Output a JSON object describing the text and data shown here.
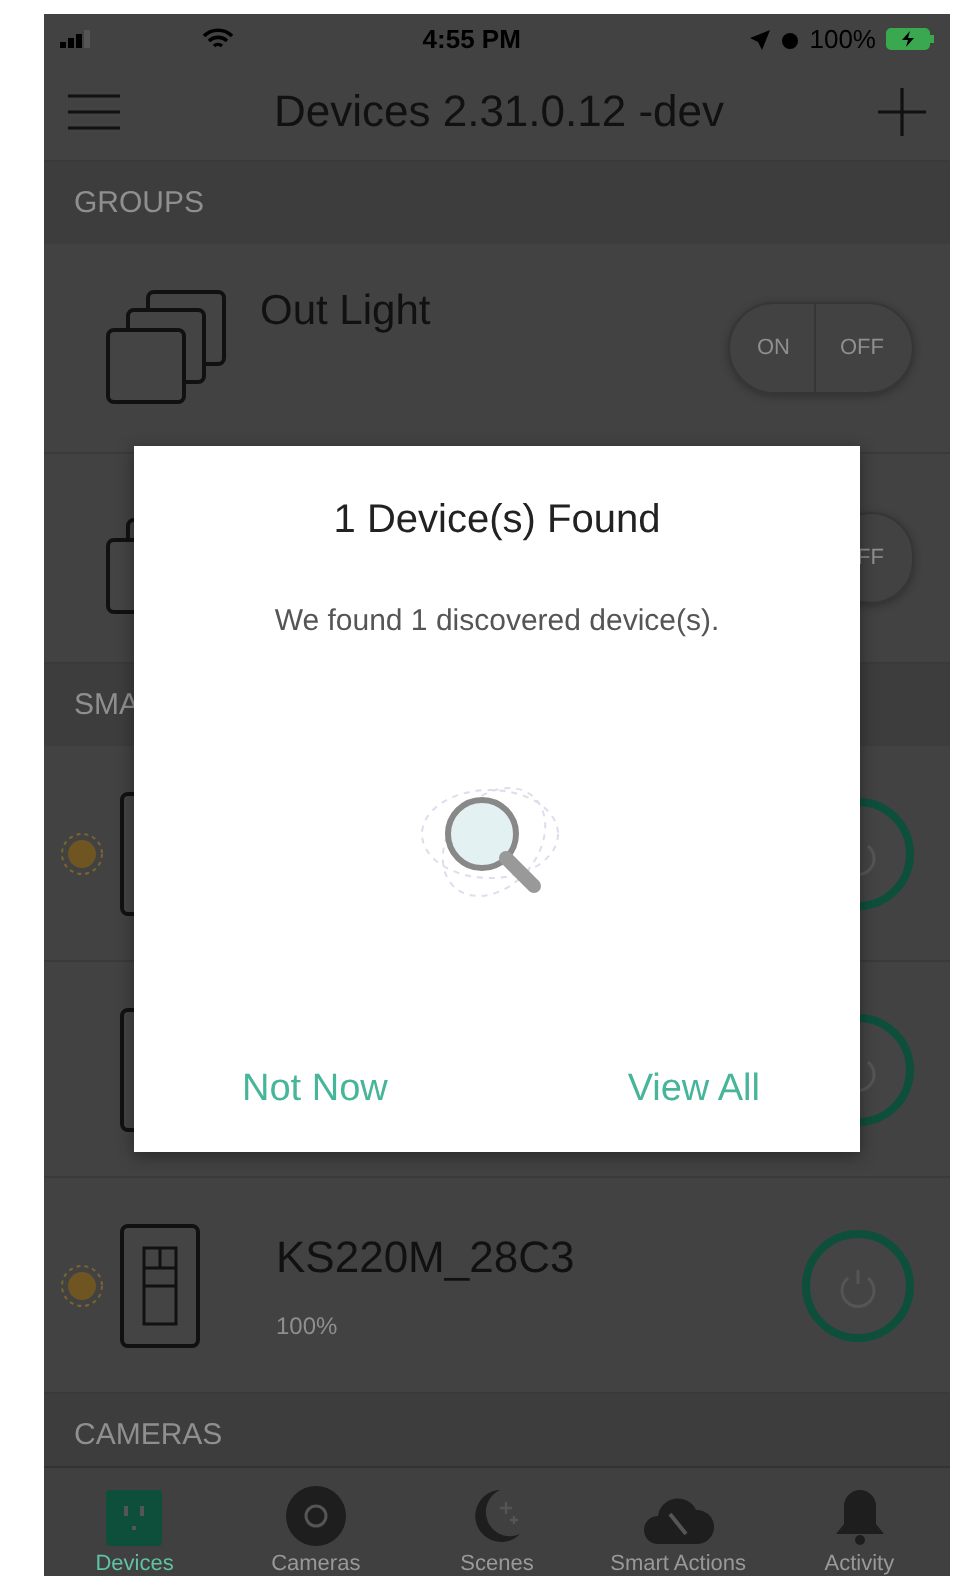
{
  "status_bar": {
    "time": "4:55 PM",
    "battery": "100%"
  },
  "nav": {
    "title": "Devices 2.31.0.12 -dev"
  },
  "groups": {
    "header": "GROUPS",
    "items": [
      {
        "name": "Out Light",
        "toggle_labels": [
          "ON",
          "OFF"
        ]
      },
      {
        "toggle_labels": [
          "FF"
        ]
      }
    ]
  },
  "smart_devices": {
    "header": "SMA",
    "items": [
      {
        "lit": true,
        "on": true
      },
      {
        "lit": false,
        "on": true
      },
      {
        "name": "KS220M_28C3",
        "detail": "100%",
        "lit": true,
        "on": true
      }
    ]
  },
  "cameras": {
    "header": "CAMERAS"
  },
  "tab_bar": [
    {
      "label": "Devices",
      "selected": true,
      "kind": "devices"
    },
    {
      "label": "Cameras",
      "selected": false,
      "kind": "cameras"
    },
    {
      "label": "Scenes",
      "selected": false,
      "kind": "scenes"
    },
    {
      "label": "Smart Actions",
      "selected": false,
      "kind": "actions"
    },
    {
      "label": "Activity",
      "selected": false,
      "kind": "activity"
    }
  ],
  "dialog": {
    "title": "1 Device(s) Found",
    "message": "We found 1 discovered device(s).",
    "buttons": [
      "Not Now",
      "View All"
    ]
  }
}
